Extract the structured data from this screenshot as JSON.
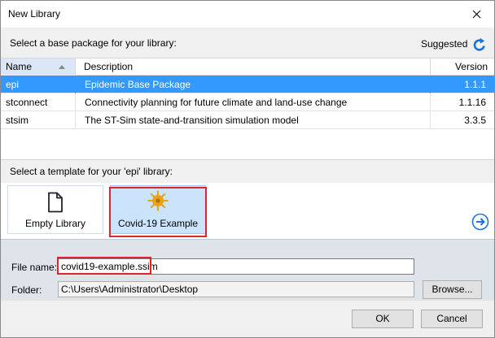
{
  "window": {
    "title": "New Library",
    "close_icon": "close-icon"
  },
  "base_section": {
    "prompt": "Select a base package for your library:",
    "suggested_label": "Suggested",
    "refresh_icon": "refresh-icon",
    "columns": [
      "Name",
      "Description",
      "Version"
    ],
    "rows": [
      {
        "name": "epi",
        "description": "Epidemic Base Package",
        "version": "1.1.1",
        "selected": true
      },
      {
        "name": "stconnect",
        "description": "Connectivity planning for future climate and land-use change",
        "version": "1.1.16",
        "selected": false
      },
      {
        "name": "stsim",
        "description": "The ST-Sim state-and-transition simulation model",
        "version": "3.3.5",
        "selected": false
      }
    ]
  },
  "template_section": {
    "prompt": "Select a template for your 'epi' library:",
    "templates": [
      {
        "label": "Empty Library",
        "icon": "document-icon",
        "selected": false
      },
      {
        "label": "Covid-19 Example",
        "icon": "virus-icon",
        "selected": true
      }
    ],
    "next_icon": "arrow-right-icon",
    "prev_icon": "arrow-left-icon"
  },
  "file_section": {
    "file_name_label": "File name:",
    "file_name_value": "covid19-example.ssim",
    "folder_label": "Folder:",
    "folder_value": "C:\\Users\\Administrator\\Desktop",
    "browse_label": "Browse..."
  },
  "buttons": {
    "ok_label": "OK",
    "cancel_label": "Cancel"
  },
  "colors": {
    "selection": "#3399ff",
    "highlight_box": "#e0242b",
    "accent_icon": "#1a73d9",
    "virus": "#e8a317"
  }
}
